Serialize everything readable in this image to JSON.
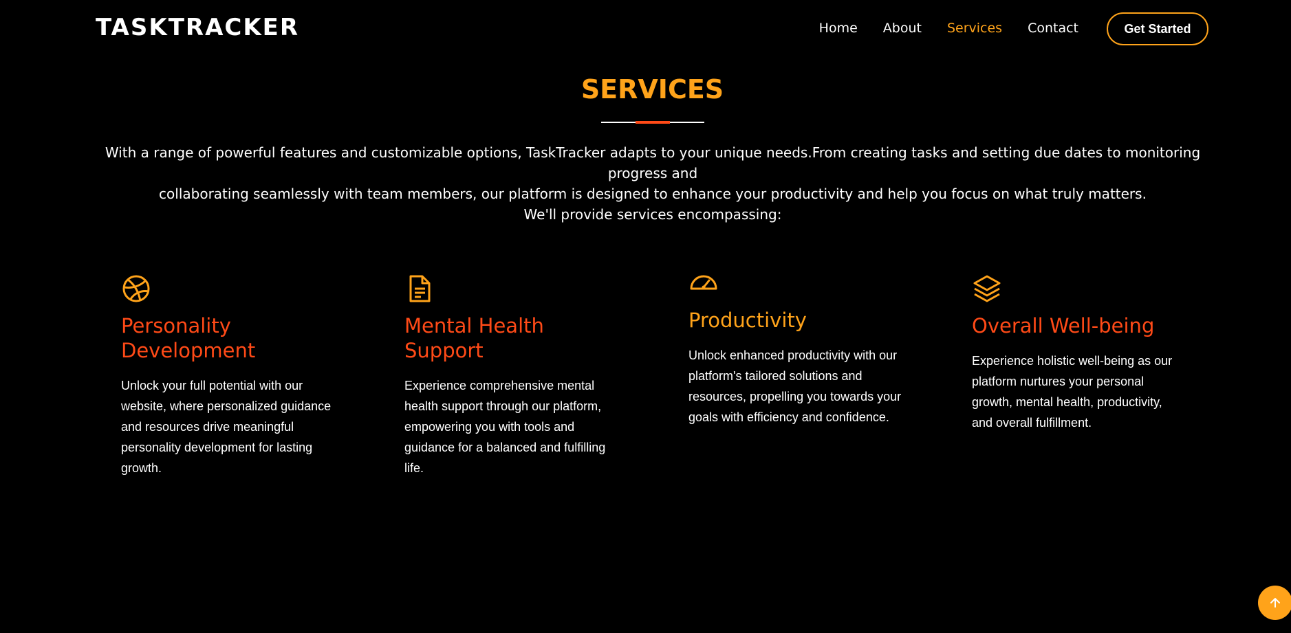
{
  "header": {
    "logo": "TASKTRACKER",
    "nav": [
      {
        "label": "Home",
        "active": false
      },
      {
        "label": "About",
        "active": false
      },
      {
        "label": "Services",
        "active": true
      },
      {
        "label": "Contact",
        "active": false
      }
    ],
    "cta_label": "Get Started"
  },
  "section": {
    "title": "SERVICES",
    "intro_line1": "With a range of powerful features and customizable options, TaskTracker adapts to your unique needs.From creating tasks and setting due dates to monitoring progress and",
    "intro_line2": "collaborating seamlessly with team members, our platform is designed to enhance your productivity and help you focus on what truly matters.",
    "intro_line3": "We'll provide services encompassing:"
  },
  "services": [
    {
      "icon": "dribbble-icon",
      "title": "Personality Development",
      "description": "Unlock your full potential with our website, where personalized guidance and resources drive meaningful personality development for lasting growth.",
      "title_color": "#ff4a17"
    },
    {
      "icon": "document-icon",
      "title": "Mental Health Support",
      "description": "Experience comprehensive mental health support through our platform, empowering you with tools and guidance for a balanced and fulfilling life.",
      "title_color": "#ff4a17"
    },
    {
      "icon": "speedometer-icon",
      "title": "Productivity",
      "description": "Unlock enhanced productivity with our platform's tailored solutions and resources, propelling you towards your goals with efficiency and confidence.",
      "title_color": "#ffa31a"
    },
    {
      "icon": "layers-icon",
      "title": "Overall Well-being",
      "description": "Experience holistic well-being as our platform nurtures your personal growth, mental health, productivity, and overall fulfillment.",
      "title_color": "#ff4a17"
    }
  ],
  "scroll_top": {
    "icon": "arrow-up-icon"
  },
  "colors": {
    "accent": "#ffa31a",
    "accent_red": "#ff4a17",
    "background": "#000000",
    "text": "#ffffff"
  }
}
